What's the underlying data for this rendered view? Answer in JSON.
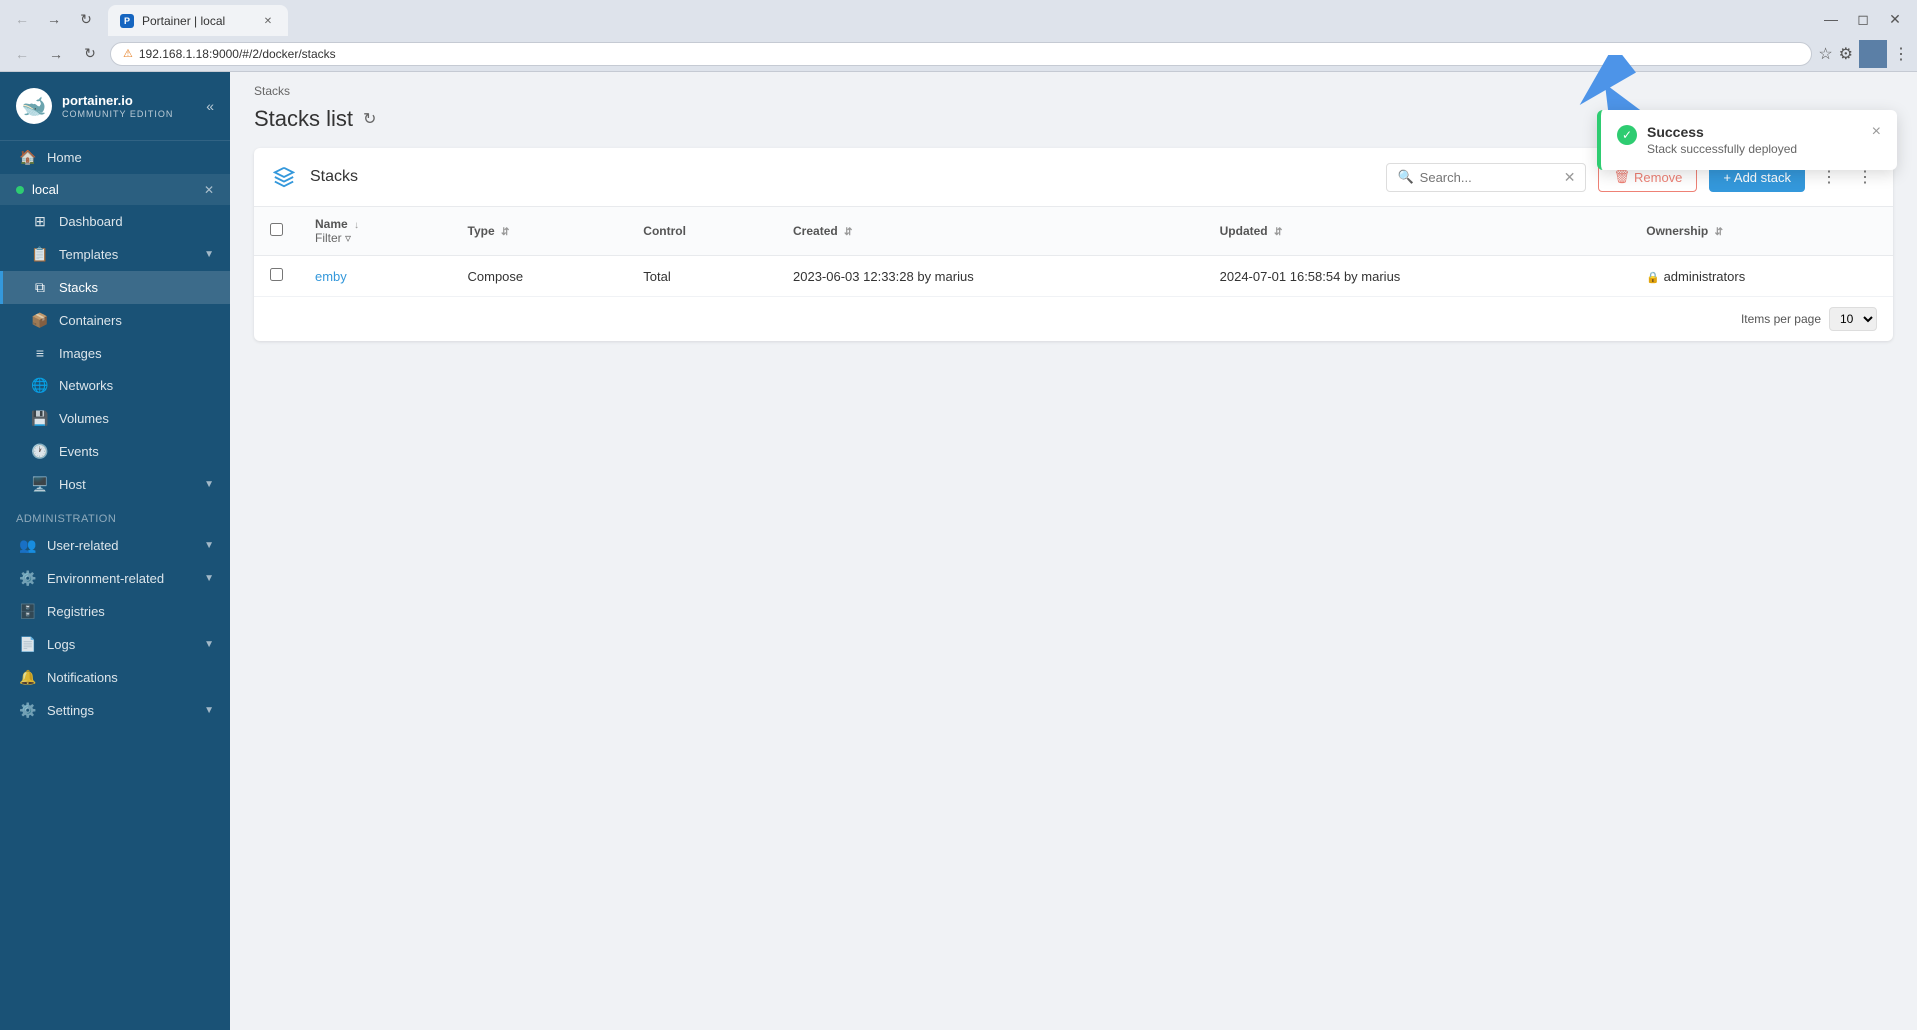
{
  "browser": {
    "tab_title": "Portainer | local",
    "url": "192.168.1.18:9000/#/2/docker/stacks",
    "url_full": "Not secure  192.168.1.18:9000/#/2/docker/stacks",
    "insecure_label": "Not secure"
  },
  "sidebar": {
    "logo_text": "portainer.io",
    "logo_sub": "COMMUNITY EDITION",
    "collapse_label": "«",
    "env_name": "local",
    "nav_items": [
      {
        "id": "home",
        "label": "Home",
        "icon": "🏠"
      },
      {
        "id": "dashboard",
        "label": "Dashboard",
        "icon": "📊"
      },
      {
        "id": "templates",
        "label": "Templates",
        "icon": "📋",
        "has_chevron": true
      },
      {
        "id": "stacks",
        "label": "Stacks",
        "icon": "🗂️",
        "active": true
      },
      {
        "id": "containers",
        "label": "Containers",
        "icon": "📦"
      },
      {
        "id": "images",
        "label": "Images",
        "icon": "≡"
      },
      {
        "id": "networks",
        "label": "Networks",
        "icon": "🌐"
      },
      {
        "id": "volumes",
        "label": "Volumes",
        "icon": "💾"
      },
      {
        "id": "events",
        "label": "Events",
        "icon": "🕐"
      },
      {
        "id": "host",
        "label": "Host",
        "icon": "🖥️",
        "has_chevron": true
      }
    ],
    "admin_section": "Administration",
    "admin_items": [
      {
        "id": "user-related",
        "label": "User-related",
        "has_chevron": true
      },
      {
        "id": "environment-related",
        "label": "Environment-related",
        "has_chevron": true
      },
      {
        "id": "registries",
        "label": "Registries"
      },
      {
        "id": "logs",
        "label": "Logs",
        "has_chevron": true
      },
      {
        "id": "notifications",
        "label": "Notifications"
      },
      {
        "id": "settings",
        "label": "Settings",
        "has_chevron": true
      }
    ]
  },
  "breadcrumb": "Stacks",
  "page_title": "Stacks list",
  "card": {
    "title": "Stacks",
    "search_placeholder": "Search...",
    "remove_label": "Remove",
    "add_stack_label": "+ Add stack",
    "items_per_page_label": "Items per page",
    "per_page_value": "10"
  },
  "table": {
    "columns": [
      {
        "id": "name",
        "label": "Name",
        "sortable": true
      },
      {
        "id": "type",
        "label": "Type",
        "sortable": true
      },
      {
        "id": "control",
        "label": "Control",
        "sortable": false
      },
      {
        "id": "created",
        "label": "Created",
        "sortable": true
      },
      {
        "id": "updated",
        "label": "Updated",
        "sortable": true
      },
      {
        "id": "ownership",
        "label": "Ownership",
        "sortable": true
      }
    ],
    "rows": [
      {
        "name": "emby",
        "type": "Compose",
        "control": "Total",
        "created": "2023-06-03 12:33:28 by marius",
        "updated": "2024-07-01 16:58:54 by marius",
        "ownership": "administrators"
      }
    ]
  },
  "toast": {
    "title": "Success",
    "message": "Stack successfully deployed",
    "close_label": "×"
  }
}
